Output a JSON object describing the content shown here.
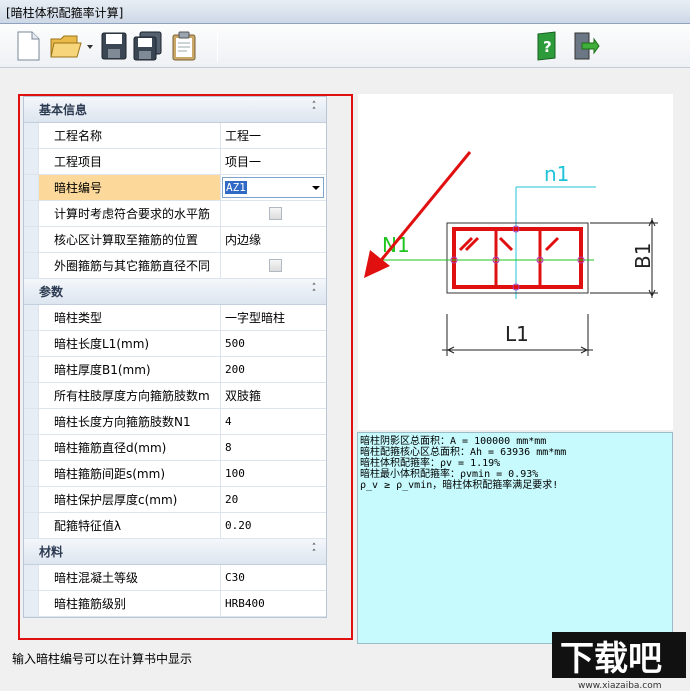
{
  "window": {
    "title": "[暗柱体积配箍率计算]"
  },
  "toolbar": {
    "buttons": [
      "new-file-icon",
      "open-folder-icon",
      "save-icon",
      "save-all-icon",
      "clipboard-icon",
      "help-icon",
      "exit-icon"
    ]
  },
  "grid": {
    "categories": [
      {
        "title": "基本信息",
        "rows": [
          {
            "name": "工程名称",
            "value": "工程一"
          },
          {
            "name": "工程项目",
            "value": "项目一"
          },
          {
            "name": "暗柱编号",
            "value": "AZ1"
          },
          {
            "name": "计算时考虑符合要求的水平筋",
            "value": ""
          },
          {
            "name": "核心区计算取至箍筋的位置",
            "value": "内边缘"
          },
          {
            "name": "外圈箍筋与其它箍筋直径不同",
            "value": ""
          }
        ]
      },
      {
        "title": "参数",
        "rows": [
          {
            "name": "暗柱类型",
            "value": "一字型暗柱"
          },
          {
            "name": "暗柱长度L1(mm)",
            "value": "500"
          },
          {
            "name": "暗柱厚度B1(mm)",
            "value": "200"
          },
          {
            "name": "所有柱肢厚度方向箍筋肢数m",
            "value": "双肢箍"
          },
          {
            "name": "暗柱长度方向箍筋肢数N1",
            "value": "4"
          },
          {
            "name": "暗柱箍筋直径d(mm)",
            "value": "8"
          },
          {
            "name": "暗柱箍筋间距s(mm)",
            "value": "100"
          },
          {
            "name": "暗柱保护层厚度c(mm)",
            "value": "20"
          },
          {
            "name": "配箍特征值λ",
            "value": "0.20"
          }
        ]
      },
      {
        "title": "材料",
        "rows": [
          {
            "name": "暗柱混凝土等级",
            "value": "C30"
          },
          {
            "name": "暗柱箍筋级别",
            "value": "HRB400"
          }
        ]
      }
    ]
  },
  "hint": "输入暗柱编号可以在计算书中显示",
  "drawing": {
    "label_n1": "n1",
    "label_N1": "N1",
    "label_B1": "B1",
    "label_L1": "L1"
  },
  "result": {
    "lines": [
      "暗柱阴影区总面积：A = 100000 mm*mm",
      "暗柱配箍核心区总面积：Ah = 63936 mm*mm",
      "暗柱体积配箍率：ρv = 1.19%",
      "暗柱最小体积配箍率：ρvmin = 0.93%",
      "ρ_v ≥ ρ_vmin，暗柱体积配箍率满足要求!"
    ]
  },
  "watermark": {
    "text": "下载吧",
    "url": "www.xiazaiba.com"
  },
  "colors": {
    "highlight_red": "#e01010",
    "result_bg": "#c6fafd",
    "selected_row": "#fcd99a",
    "drawing_green": "#1fc41f",
    "drawing_cyan": "#1fc4d9",
    "drawing_red": "#e01010"
  }
}
